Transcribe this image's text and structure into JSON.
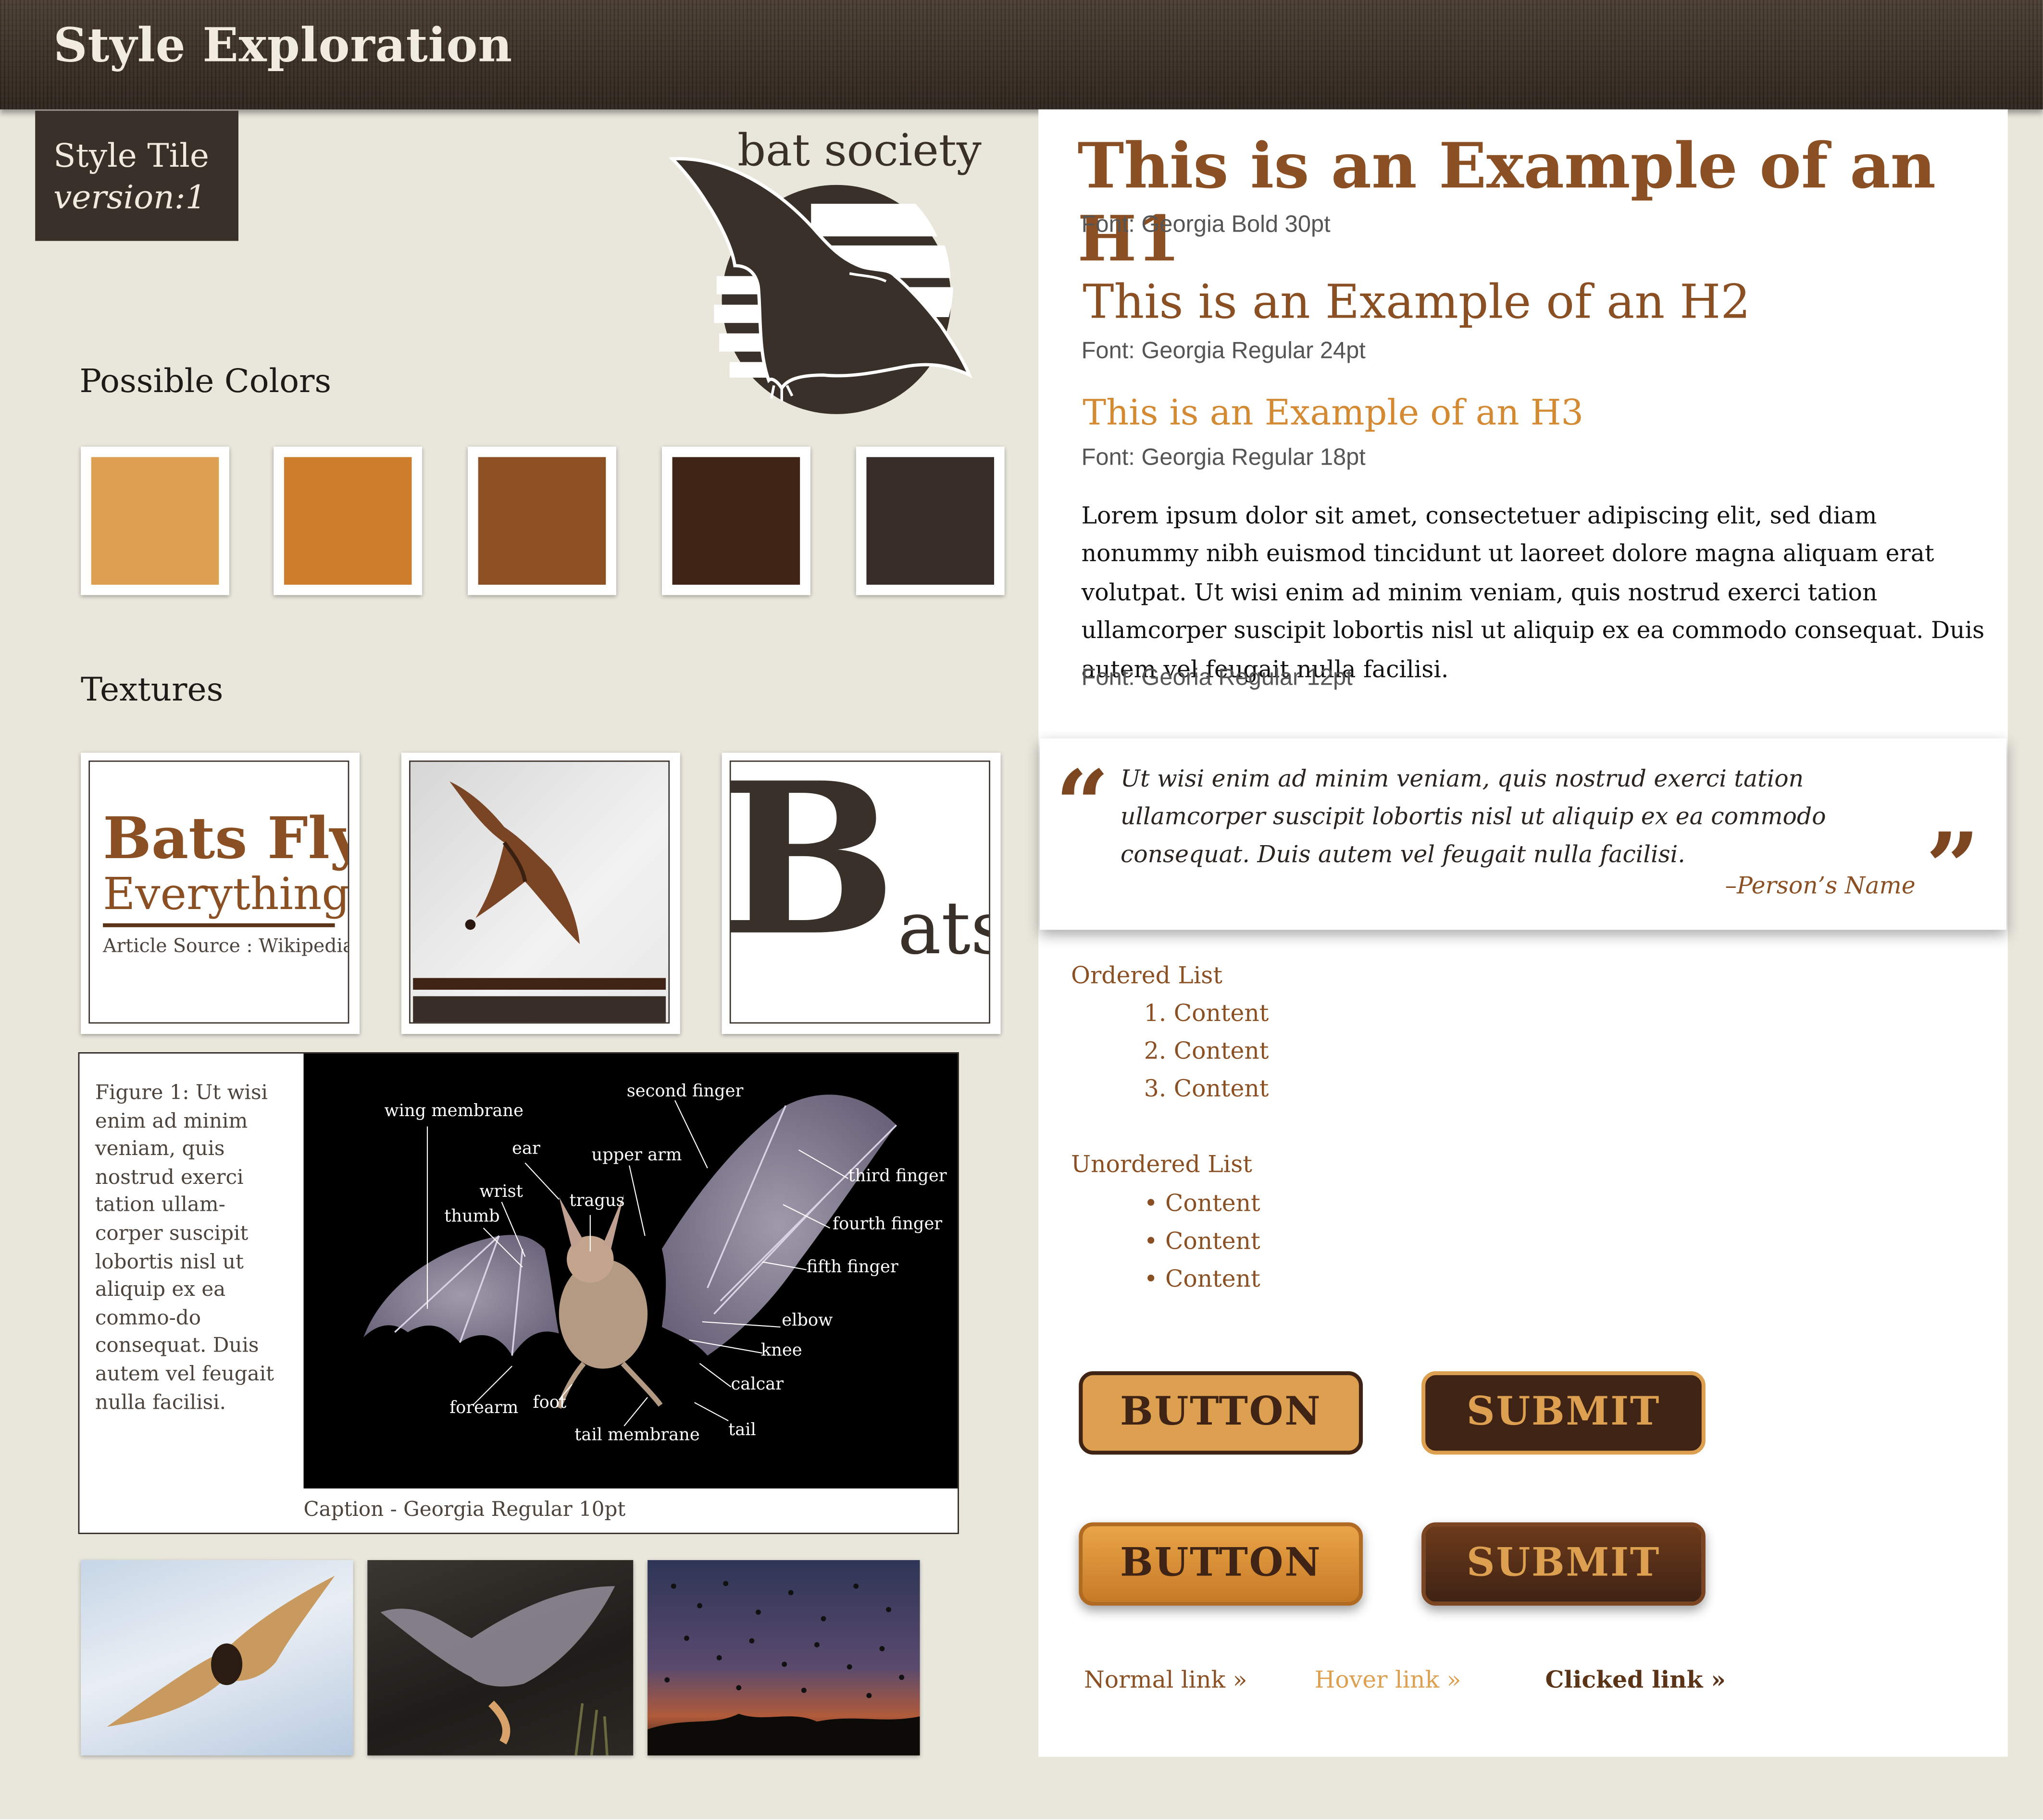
{
  "header": {
    "title": "Style Exploration"
  },
  "badge": {
    "line1": "Style Tile",
    "line2": "version:1"
  },
  "logo": {
    "text": "bat society"
  },
  "colors_section": {
    "title": "Possible Colors",
    "swatches": [
      "#dda050",
      "#cd7f2d",
      "#8d5022",
      "#3f2314",
      "#382d27"
    ]
  },
  "textures_section": {
    "title": "Textures",
    "tile1": {
      "line1": "Bats Fly",
      "line2": "Everything",
      "source": "Article Source : Wikipedia"
    },
    "tile3": {
      "big_letter": "B",
      "rest": "ats"
    }
  },
  "figure": {
    "text": "Figure 1: Ut wisi enim ad minim veniam, quis nostrud exerci tation ullam-corper suscipit lobortis nisl ut aliquip ex ea commo-do consequat. Duis autem vel feugait nulla facilisi.",
    "caption": "Caption - Georgia Regular 10pt",
    "labels": {
      "wing_membrane": "wing membrane",
      "second_finger": "second finger",
      "ear": "ear",
      "upper_arm": "upper arm",
      "wrist": "wrist",
      "thumb": "thumb",
      "tragus": "tragus",
      "third_finger": "third finger",
      "fourth_finger": "fourth finger",
      "fifth_finger": "fifth finger",
      "elbow": "elbow",
      "knee": "knee",
      "calcar": "calcar",
      "forearm": "forearm",
      "foot": "foot",
      "tail": "tail",
      "tail_membrane": "tail membrane"
    }
  },
  "typography": {
    "h1": "This is an Example of an H1",
    "h1_note": "Font: Georgia Bold 30pt",
    "h2": "This is an Example of an H2",
    "h2_note": "Font: Georgia Regular 24pt",
    "h3": "This is an Example of an H3",
    "h3_note": "Font: Georgia Regular 18pt",
    "body": "Lorem ipsum dolor sit amet, consectetuer adipiscing elit, sed diam nonummy nibh euismod tincidunt ut laoreet dolore magna aliquam erat volutpat. Ut wisi enim ad minim veniam, quis nostrud exerci tation ullamcorper suscipit lobortis nisl ut aliquip ex ea commodo consequat. Duis autem vel feugait nulla facilisi.",
    "body_note": "Font: Georia Regular 12pt"
  },
  "quote": {
    "open_mark": "“",
    "close_mark": "”",
    "text": "Ut wisi enim ad minim veniam, quis nostrud exerci tation ullamcorper suscipit lobortis nisl ut aliquip ex ea commodo consequat. Duis autem vel feugait nulla facilisi.",
    "author": "–Person’s Name"
  },
  "ordered_list": {
    "title": "Ordered List",
    "items": [
      "1. Content",
      "2. Content",
      "3. Content"
    ]
  },
  "unordered_list": {
    "title": "Unordered List",
    "items": [
      "• Content",
      "• Content",
      "• Content"
    ]
  },
  "buttons": {
    "button_label": "BUTTON",
    "submit_label": "SUBMIT"
  },
  "links": {
    "normal": "Normal link »",
    "hover": "Hover link »",
    "clicked": "Clicked link »"
  },
  "theme_colors": {
    "light_orange": "#dda050",
    "orange": "#cd7f2d",
    "brown": "#8d5022",
    "dark_brown": "#3f2314",
    "charcoal": "#382d27"
  }
}
